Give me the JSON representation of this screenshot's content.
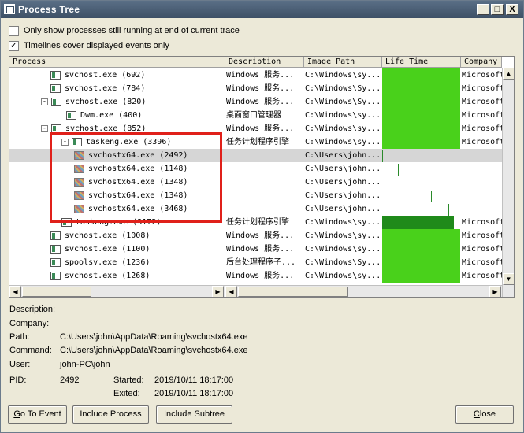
{
  "window": {
    "title": "Process Tree"
  },
  "titlebar_buttons": {
    "minimize": "_",
    "maximize": "□",
    "close": "X"
  },
  "options": {
    "only_running": {
      "label": "Only show processes still running at end of current trace",
      "checked": false,
      "mark": ""
    },
    "timelines": {
      "label": "Timelines cover displayed events only",
      "checked": true,
      "mark": "✓"
    }
  },
  "columns": {
    "process": "Process",
    "description": "Description",
    "image_path": "Image Path",
    "life_time": "Life Time",
    "company": "Company"
  },
  "rows": [
    {
      "name": "svchost.exe (692)",
      "desc": "Windows 服务...",
      "path": "C:\\Windows\\sy...",
      "company": "Microsoft",
      "icon": "window",
      "life": 1.0
    },
    {
      "name": "svchost.exe (784)",
      "desc": "Windows 服务...",
      "path": "C:\\Windows\\Sy...",
      "company": "Microsoft",
      "icon": "window",
      "life": 1.0
    },
    {
      "name": "svchost.exe (820)",
      "desc": "Windows 服务...",
      "path": "C:\\Windows\\Sy...",
      "company": "Microsoft",
      "icon": "window",
      "expander": "-",
      "life": 1.0
    },
    {
      "name": "Dwm.exe (400)",
      "desc": "桌面窗口管理器",
      "path": "C:\\Windows\\sy...",
      "company": "Microsoft",
      "icon": "window",
      "life": 1.0
    },
    {
      "name": "svchost.exe (852)",
      "desc": "Windows 服务...",
      "path": "C:\\Windows\\sy...",
      "company": "Microsoft",
      "icon": "window",
      "expander": "-",
      "life": 1.0
    },
    {
      "name": "taskeng.exe (3396)",
      "desc": "任务计划程序引擎",
      "path": "C:\\Windows\\sy...",
      "company": "Microsoft",
      "icon": "window",
      "expander": "-",
      "life": 1.0
    },
    {
      "name": "svchostx64.exe (2492)",
      "desc": "",
      "path": "C:\\Users\\john...",
      "company": "",
      "icon": "mosaic",
      "life": 0.01,
      "selected": true
    },
    {
      "name": "svchostx64.exe (1148)",
      "desc": "",
      "path": "C:\\Users\\john...",
      "company": "",
      "icon": "mosaic",
      "life": 0.01
    },
    {
      "name": "svchostx64.exe (1348)",
      "desc": "",
      "path": "C:\\Users\\john...",
      "company": "",
      "icon": "mosaic",
      "life": 0.01
    },
    {
      "name": "svchostx64.exe (1348)",
      "desc": "",
      "path": "C:\\Users\\john...",
      "company": "",
      "icon": "mosaic",
      "life": 0.01
    },
    {
      "name": "svchostx64.exe (3468)",
      "desc": "",
      "path": "C:\\Users\\john...",
      "company": "",
      "icon": "mosaic",
      "life": 0.01
    },
    {
      "name": "taskeng.exe (3172)",
      "desc": "任务计划程序引擎",
      "path": "C:\\Windows\\sy...",
      "company": "Microsoft",
      "icon": "window",
      "life": 0.92,
      "dark": true
    },
    {
      "name": "svchost.exe (1008)",
      "desc": "Windows 服务...",
      "path": "C:\\Windows\\sy...",
      "company": "Microsoft",
      "icon": "window",
      "life": 1.0
    },
    {
      "name": "svchost.exe (1100)",
      "desc": "Windows 服务...",
      "path": "C:\\Windows\\sy...",
      "company": "Microsoft",
      "icon": "window",
      "life": 1.0
    },
    {
      "name": "spoolsv.exe (1236)",
      "desc": "后台处理程序子...",
      "path": "C:\\Windows\\Sy...",
      "company": "Microsoft",
      "icon": "window",
      "life": 1.0
    },
    {
      "name": "svchost.exe (1268)",
      "desc": "Windows 服务...",
      "path": "C:\\Windows\\sy...",
      "company": "Microsoft",
      "icon": "window",
      "life": 1.0
    }
  ],
  "details": {
    "description_label": "Description:",
    "company_label": "Company:",
    "path_label": "Path:",
    "path_value": "C:\\Users\\john\\AppData\\Roaming\\svchostx64.exe",
    "command_label": "Command:",
    "command_value": "C:\\Users\\john\\AppData\\Roaming\\svchostx64.exe",
    "user_label": "User:",
    "user_value": "john-PC\\john",
    "pid_label": "PID:",
    "pid_value": "2492",
    "started_label": "Started:",
    "started_value": "2019/10/11 18:17:00",
    "exited_label": "Exited:",
    "exited_value": "2019/10/11 18:17:00"
  },
  "buttons": {
    "goto_prefix": "G",
    "goto_rest": "o To Event",
    "include_process": "Include Process",
    "include_subtree": "Include Subtree",
    "close_prefix": "C",
    "close_rest": "lose"
  },
  "colors": {
    "life_bar": "#49d11b",
    "life_bar_dark": "#1f8a1a",
    "highlight": "#e0201a"
  }
}
